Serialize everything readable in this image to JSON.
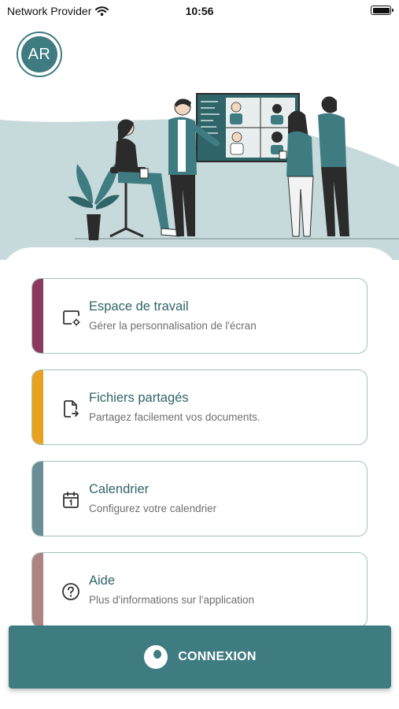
{
  "status_bar": {
    "carrier": "Network Provider",
    "time": "10:56"
  },
  "header": {
    "avatar_initials": "AR"
  },
  "menu": [
    {
      "title": "Espace de travail",
      "subtitle": "Gérer la personnalisation de l'écran",
      "icon": "screen-settings-icon",
      "accent": "#8a3a5c"
    },
    {
      "title": "Fichiers partagés",
      "subtitle": "Partagez facilement vos documents.",
      "icon": "file-share-icon",
      "accent": "#e8a21f"
    },
    {
      "title": "Calendrier",
      "subtitle": "Configurez votre calendrier",
      "icon": "calendar-icon",
      "accent": "#6a8e97"
    },
    {
      "title": "Aide",
      "subtitle": "Plus d'informations sur l'application",
      "icon": "help-icon",
      "accent": "#b08383"
    }
  ],
  "connect_button": {
    "label": "CONNEXION",
    "icon": "power-icon"
  },
  "colors": {
    "primary": "#3f7c82",
    "border": "#9fc1c3",
    "hero_bg": "#c7dadb"
  }
}
